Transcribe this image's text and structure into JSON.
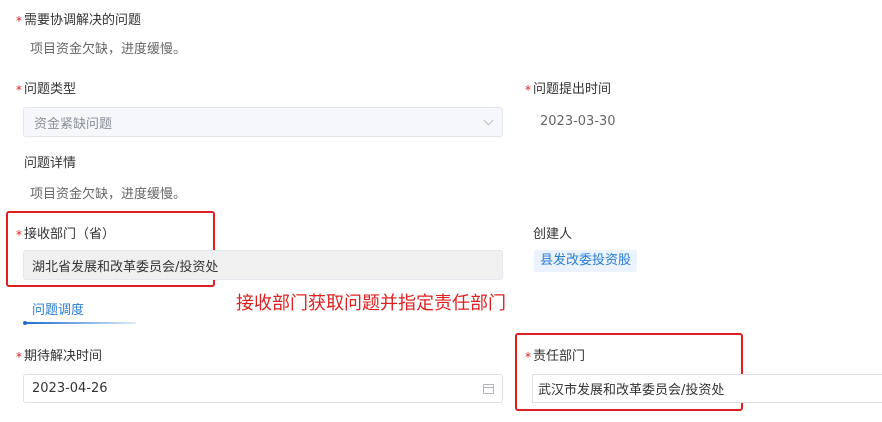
{
  "required_mark": "*",
  "problem_to_coordinate": {
    "label": "需要协调解决的问题",
    "value": "项目资金欠缺，进度缓慢。"
  },
  "problem_type": {
    "label": "问题类型",
    "selected": "资金紧缺问题",
    "icon": "chevron-down-icon"
  },
  "submit_time": {
    "label": "问题提出时间",
    "value": "2023-03-30"
  },
  "problem_detail": {
    "label": "问题详情",
    "value": "项目资金欠缺，进度缓慢。"
  },
  "receiving_dept": {
    "label": "接收部门（省）",
    "value": "湖北省发展和改革委员会/投资处"
  },
  "creator": {
    "label": "创建人",
    "value": "县发改委投资股"
  },
  "tab": {
    "label": "问题调度"
  },
  "annotation": {
    "text": "接收部门获取问题并指定责任部门",
    "color": "#e02020"
  },
  "expected_time": {
    "label": "期待解决时间",
    "value": "2023-04-26",
    "icon": "calendar-icon"
  },
  "responsible_dept": {
    "label": "责任部门",
    "value": "武汉市发展和改革委员会/投资处"
  },
  "colors": {
    "accent": "#2a7dd6",
    "highlight_red": "#e02020",
    "tag_bg": "#eaf3ff"
  }
}
